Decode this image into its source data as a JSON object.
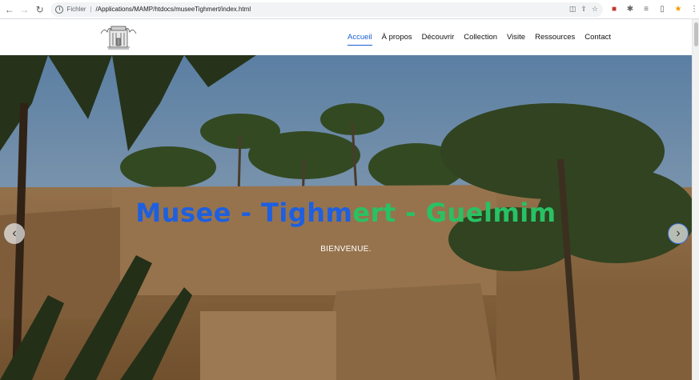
{
  "browser": {
    "scheme_label": "Fichler",
    "url": "/Applications/MAMP/htdocs/museeTighmert/index.html"
  },
  "site": {
    "nav": [
      {
        "label": "Accueil",
        "active": true
      },
      {
        "label": "À propos",
        "active": false
      },
      {
        "label": "Découvrir",
        "active": false
      },
      {
        "label": "Collection",
        "active": false
      },
      {
        "label": "Visite",
        "active": false
      },
      {
        "label": "Ressources",
        "active": false
      },
      {
        "label": "Contact",
        "active": false
      }
    ]
  },
  "hero": {
    "title_blue": "Musee - Tighm",
    "title_green": "ert - Guelmim",
    "subtitle": "BIENVENUE.",
    "prev_icon": "‹",
    "next_icon": "›"
  },
  "colors": {
    "accent": "#1b5fd1",
    "title_blue": "#1e5fe0",
    "title_green": "#28c264"
  }
}
